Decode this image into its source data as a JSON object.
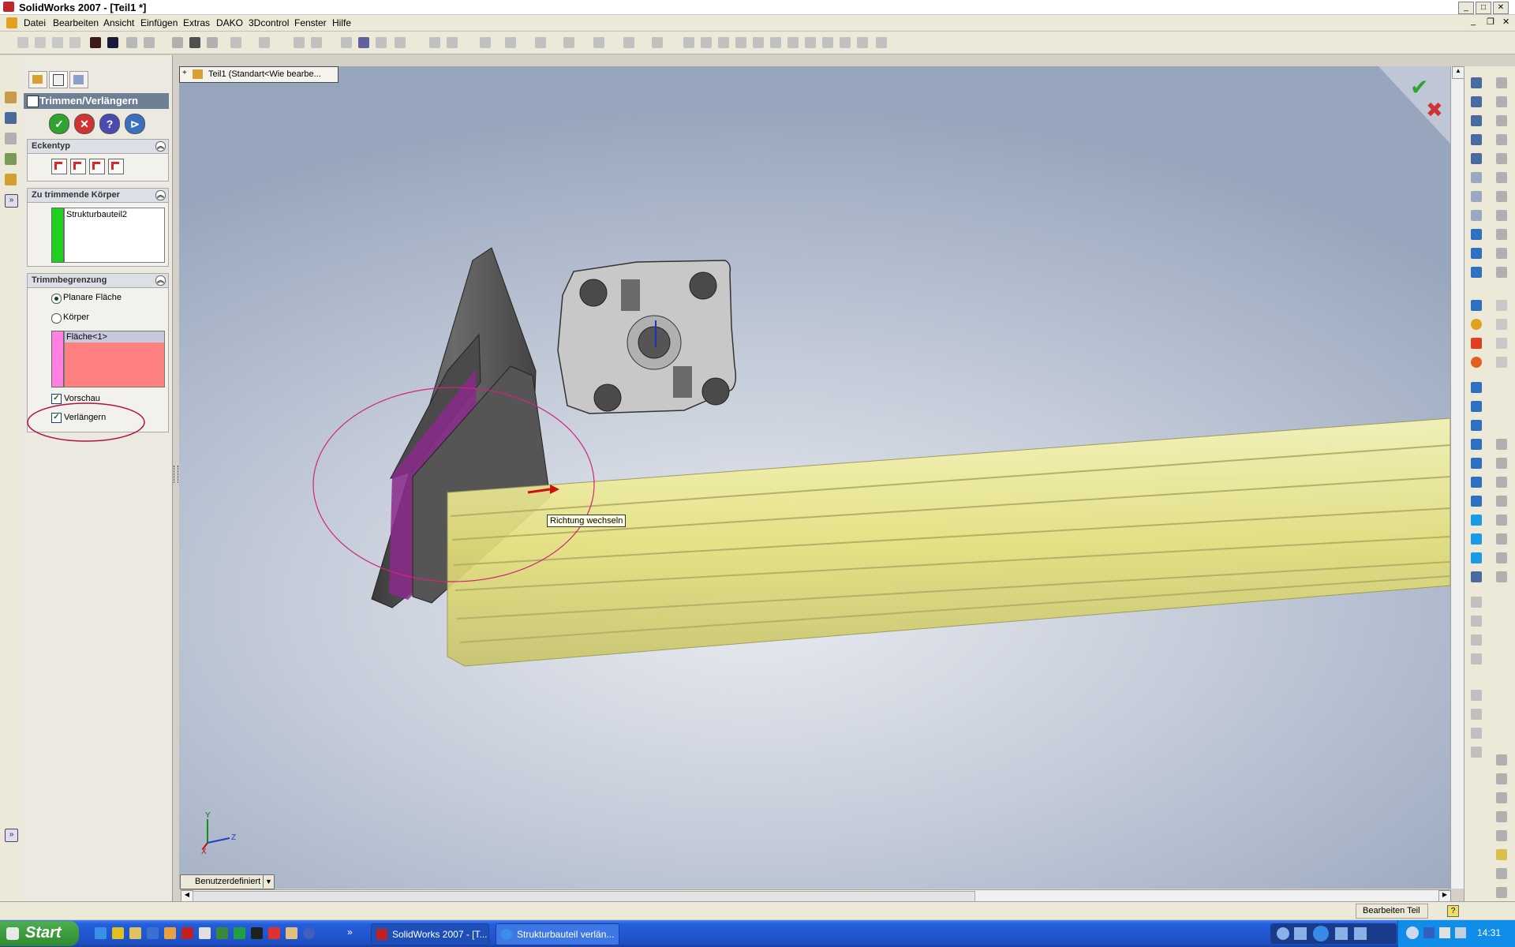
{
  "window": {
    "title": "SolidWorks 2007 - [Teil1 *]"
  },
  "menu": [
    "Datei",
    "Bearbeiten",
    "Ansicht",
    "Einfügen",
    "Extras",
    "DAKO",
    "3Dcontrol",
    "Fenster",
    "Hilfe"
  ],
  "property_manager": {
    "title": "Trimmen/Verlängern",
    "groups": {
      "corner_type": {
        "title": "Eckentyp"
      },
      "bodies_to_trim": {
        "title": "Zu trimmende Körper",
        "items": [
          "Strukturbauteil2"
        ]
      },
      "trim_boundary": {
        "title": "Trimmbegrenzung",
        "radio_planar": "Planare Fläche",
        "radio_body": "Körper",
        "selection": "Fläche<1>",
        "check_preview": "Vorschau",
        "check_extend": "Verlängern"
      }
    }
  },
  "graphics": {
    "tree_tab": "Teil1  (Standart<Wie bearbe...",
    "tooltip": "Richtung wechseln",
    "view_orientation": "Benutzerdefiniert",
    "axis_labels": {
      "y": "Y",
      "z": "Z",
      "x": "X"
    }
  },
  "status": {
    "mode": "Bearbeiten Teil"
  },
  "taskbar": {
    "start": "Start",
    "tasks": [
      "SolidWorks 2007 - [T...",
      "Strukturbauteil verlän..."
    ],
    "clock": "14:31"
  },
  "colors": {
    "pm_header": "#6f7f95",
    "profile_yellow": "#f2ef9a",
    "selection_pink": "#ff8080",
    "highlight_magenta": "#d0257a",
    "ok_green": "#2fa52f",
    "cancel_red": "#d23232"
  }
}
